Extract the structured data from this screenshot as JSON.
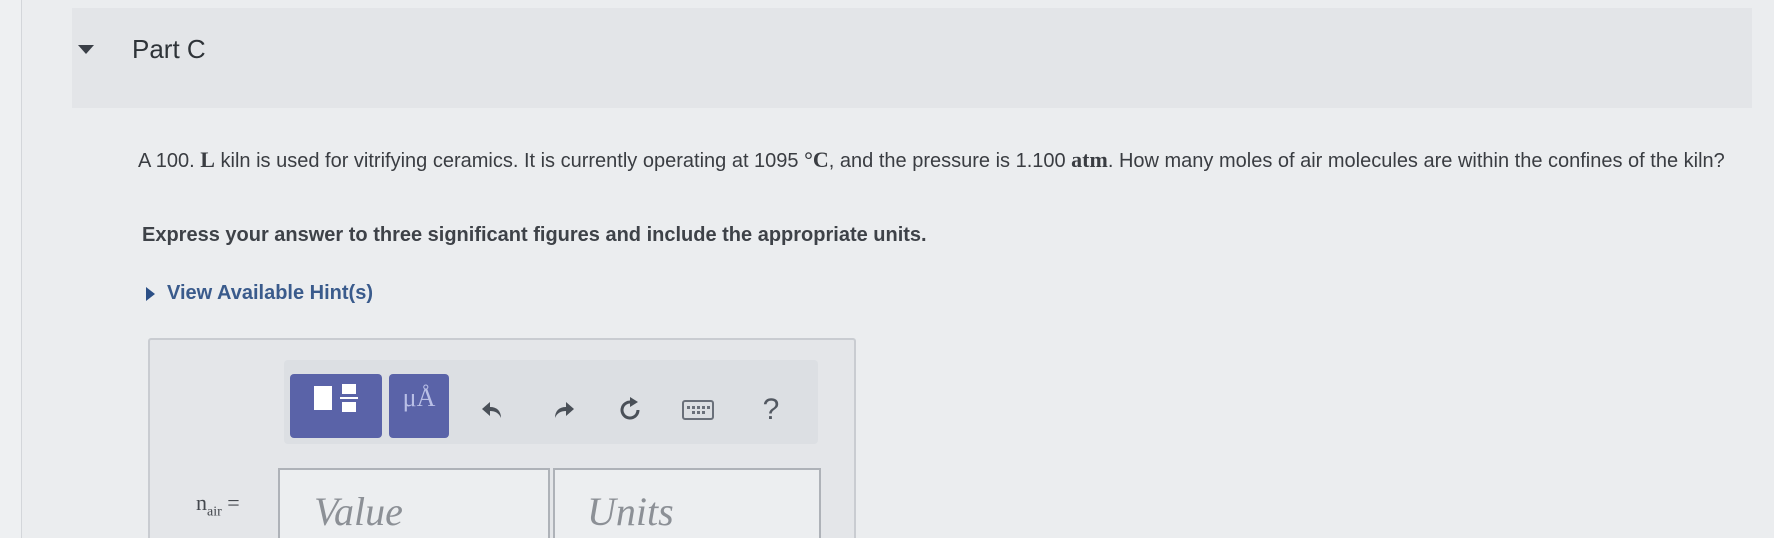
{
  "part": {
    "title": "Part C"
  },
  "question": {
    "segments": [
      "A 100. ",
      "L",
      " kiln is used for vitrifying ceramics. It is currently operating at 1095 ",
      "°C",
      ", and the pressure is 1.100 ",
      "atm",
      ". How many moles of air molecules are within the confines of the kiln?"
    ],
    "instructions": "Express your answer to three significant figures and include the appropriate units."
  },
  "hints": {
    "label": "View Available Hint(s)"
  },
  "toolbar": {
    "units_label": "μÅ",
    "templates_icon": "templates-icon",
    "undo_icon": "undo-icon",
    "redo_icon": "redo-icon",
    "reset_icon": "reset-icon",
    "keyboard_icon": "keyboard-icon",
    "help_label": "?"
  },
  "answer": {
    "variable": "n",
    "variable_subscript": "air",
    "equals": "=",
    "value_placeholder": "Value",
    "units_placeholder": "Units"
  },
  "colors": {
    "accent": "#5a63a8",
    "link": "#3a5b8c",
    "background": "#ebedef"
  }
}
